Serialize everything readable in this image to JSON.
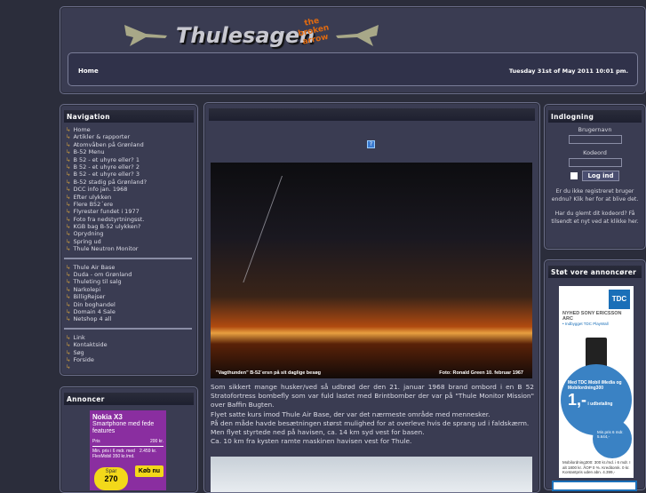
{
  "header": {
    "logo_text": "Thulesagen",
    "logo_tagline": "the broken arrow",
    "nav_home": "Home",
    "date": "Tuesday 31st of May 2011 10:01 pm."
  },
  "navigation": {
    "title": "Navigation",
    "group1": [
      "Home",
      "Artikler & rapporter",
      "Atomvåben på Grønland",
      "B-52 Menu",
      "B 52 - et uhyre eller? 1",
      "B 52 - et uhyre eller? 2",
      "B 52 - et uhyre eller? 3",
      "B-52 stadig på Grønland?",
      "DCC info jan. 1968",
      "Efter ulykken",
      "Flere B52´ere",
      "Flyrester fundet i 1977",
      "Foto fra nedstyrtningsst.",
      "KGB bag B-52 ulykken?",
      "Oprydning",
      "Spring ud",
      "Thule Neutron Monitor"
    ],
    "group2": [
      "Thule Air Base",
      "Duda - om Grønland",
      "Thuleting til salg",
      "Narkolepi",
      "BilligRejser",
      "Din boghandel",
      "Domain 4 Sale",
      "Netshop 4 all"
    ],
    "group3": [
      "Link",
      "Kontaktside",
      "Søg",
      "Forside",
      ""
    ]
  },
  "annoncer": {
    "title": "Annoncer",
    "ad": {
      "title": "Nokia X3",
      "subtitle": "Smartphone med fede features",
      "price_label": "Pris",
      "price": "200 kr.",
      "min_label": "Min. pris i 6 mdr. med FlexMobil 350 kr./md.",
      "min_price": "2.459 kr.",
      "spar": "Spar",
      "spar_value": "270",
      "buy": "Køb nu"
    }
  },
  "main": {
    "photo_caption_left": "\"Vagthunden\" B-52´ersn på sit daglige besøg",
    "photo_caption_right": "Foto: Ronald Green 10. februar 1967",
    "paragraphs": [
      "Som sikkert mange husker/ved så udbrød der den 21. januar 1968 brand ombord i en B 52 Stratofortress bombefly som var fuld lastet med Brintbomber der var på \"Thule Monitor Mission\" over Baffin Bugten.",
      "Flyet satte kurs imod Thule Air Base, der var det nærmeste område med mennesker.",
      "På den måde havde besætningen størst mulighed for at overleve hvis de sprang ud i faldskærm.",
      "Men flyet styrtede ned på havisen, ca. 14 km syd vest for basen.",
      "Ca. 10 km fra kysten ramte maskinen havisen vest for Thule."
    ]
  },
  "login": {
    "title": "Indlogning",
    "username_label": "Brugernavn",
    "password_label": "Kodeord",
    "username_value": "",
    "password_value": "",
    "login_button": "Log ind",
    "register_text": "Er du ikke registreret bruger endnu? Klik her for at blive det.",
    "forgot_text": "Har du glemt dit kodeord? Få tilsendt et nyt ved at klikke her."
  },
  "sponsors": {
    "title": "Støt vore annoncører",
    "ad": {
      "brand": "TDC",
      "headline": "NYHED SONY ERICSSON ARC",
      "sub": "• Indbygget TDC PlayWall",
      "offer": "Med TDC Mobil iMedia og Mobilordning300",
      "price": "1,-",
      "price_label": "i udbetaling",
      "min": "Min.pris 6 mdr. 5.644,-",
      "fine": "Mobilordning300: 300 kr./md. i 6 mdr. I alt 1800 kr. ÅOP 0 %. Kreditomk. 0 kr. Kontantpris uden abn. 4.399,-"
    }
  }
}
